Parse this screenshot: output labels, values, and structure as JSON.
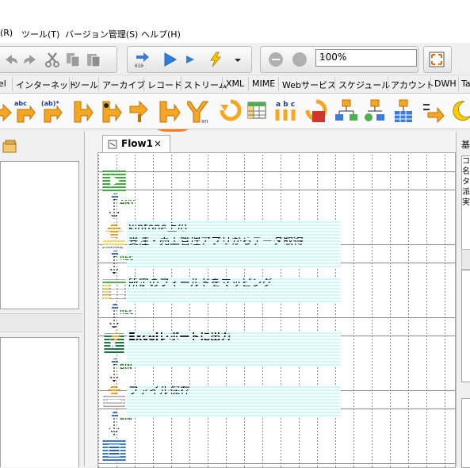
{
  "menu": [
    {
      "label": "(R)"
    },
    {
      "label": "ツール(T)"
    },
    {
      "label": "バージョン管理(S)"
    },
    {
      "label": "ヘルプ(H)"
    }
  ],
  "toolbar": {
    "zoom_value": "100%"
  },
  "category_tabs": [
    {
      "label": "el"
    },
    {
      "label": "インターネット"
    },
    {
      "label": "ツール"
    },
    {
      "label": "アーカイブ"
    },
    {
      "label": "レコード"
    },
    {
      "label": "ストリーム"
    },
    {
      "label": "XML"
    },
    {
      "label": "MIME"
    },
    {
      "label": "Webサービス"
    },
    {
      "label": "スケジュール"
    },
    {
      "label": "アカウント"
    },
    {
      "label": "DWH"
    },
    {
      "label": "Ta"
    }
  ],
  "palette_labels": {
    "abc1": "abc",
    "abc2": "(ab)*",
    "abc3": "a b c",
    "xn": "xn"
  },
  "editor": {
    "tab_title": "Flow1",
    "tab_close": "×"
  },
  "flow": {
    "nodes": [
      {
        "label_line1": "kintone上の",
        "label_line2": "受注・売上管理アプリからデータ取得",
        "icon_caption": "kintone",
        "out_port": "REC"
      },
      {
        "label_line1": "所定のフィールドをマッピング",
        "out_port": "REC"
      },
      {
        "label_line1": "Excelレポートに出力",
        "out_port": "BIN"
      },
      {
        "label_line1": "ファイル保存",
        "out_port": "BIN"
      }
    ],
    "start_port": "ANY"
  },
  "right_panel": {
    "header": "基",
    "chars": [
      "コ",
      "名",
      "タ",
      "派",
      "実"
    ]
  },
  "colors": {
    "highlight": "#ff7a1a",
    "node_label_bg": "#ccfafc",
    "port_blue": "#3d7bd8",
    "port_text_green": "#1f7a1f"
  }
}
